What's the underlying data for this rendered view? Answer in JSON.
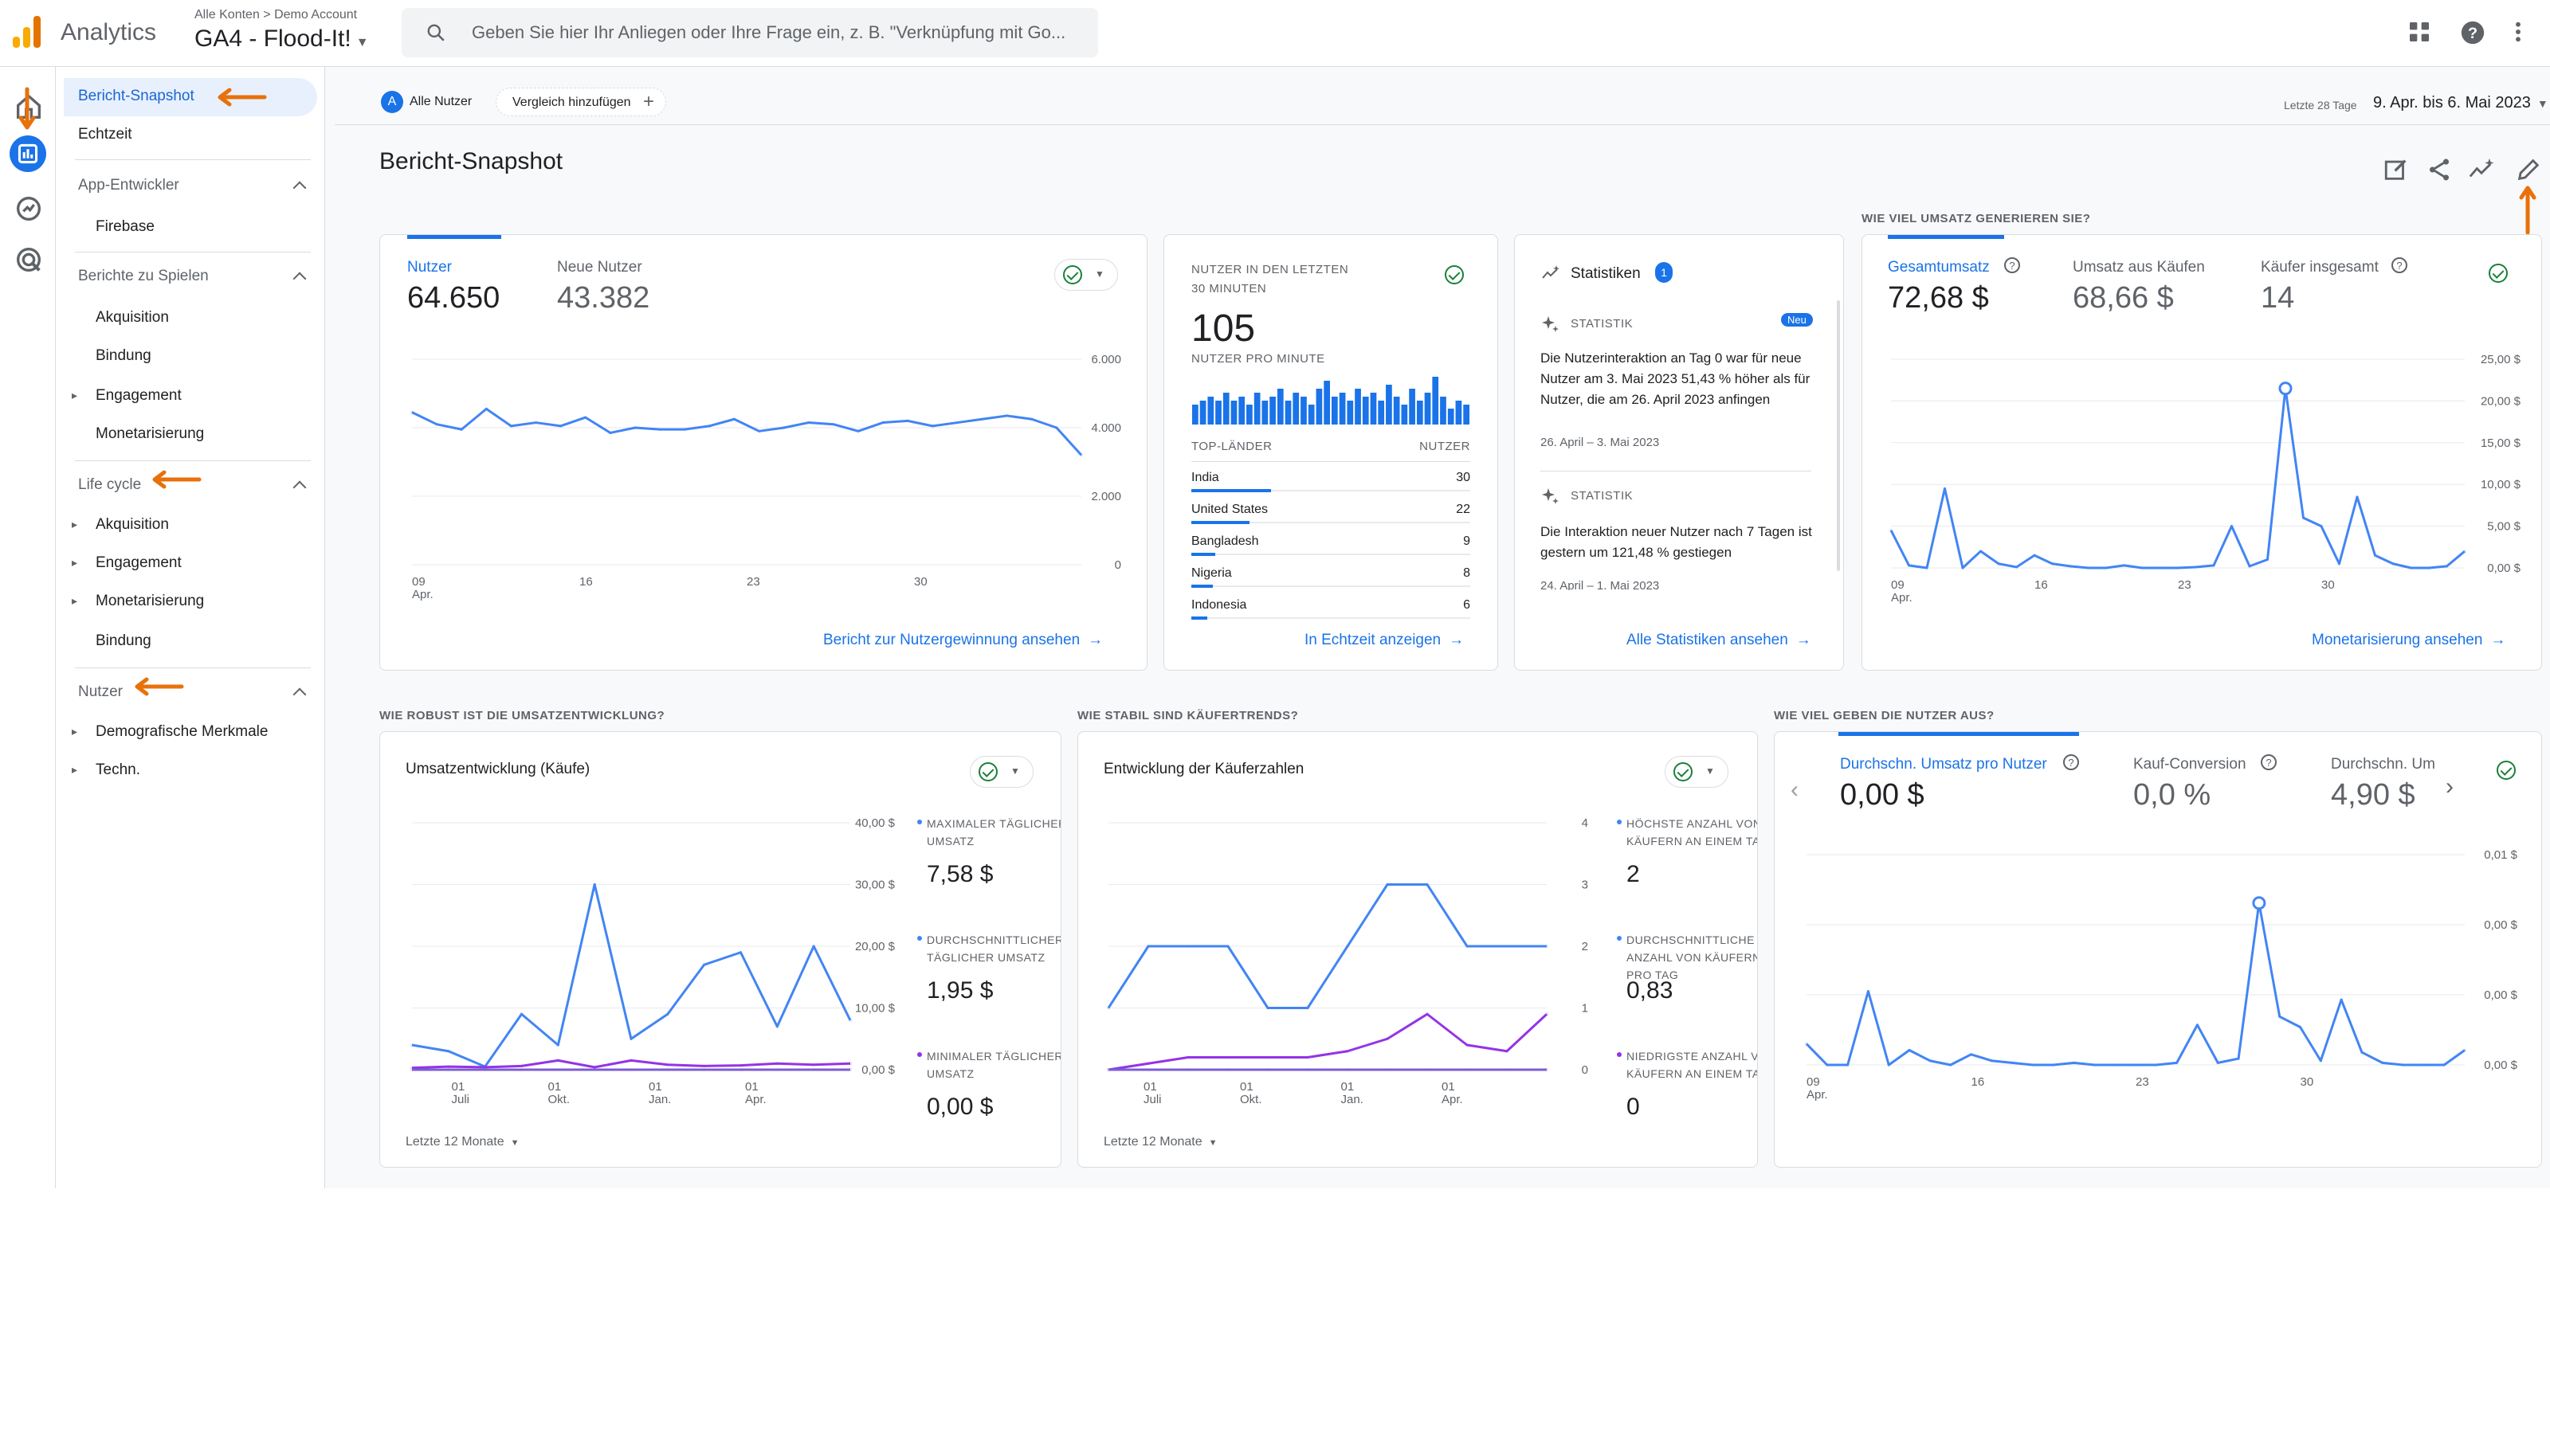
{
  "topbar": {
    "brand": "Analytics",
    "breadcrumb": "Alle Konten > Demo Account",
    "property": "GA4 - Flood-It!",
    "search_placeholder": "Geben Sie hier Ihr Anliegen oder Ihre Frage ein, z. B. \"Verknüpfung mit Go...",
    "colors": {
      "logo": [
        "#f9ab00",
        "#e37400"
      ]
    }
  },
  "sidenav": {
    "snapshot": "Bericht-Snapshot",
    "realtime": "Echtzeit",
    "app_dev": "App-Entwickler",
    "firebase": "Firebase",
    "games": "Berichte zu Spielen",
    "games_items": [
      "Akquisition",
      "Bindung",
      "Engagement",
      "Monetarisierung"
    ],
    "lifecycle": "Life cycle",
    "lifecycle_items": [
      "Akquisition",
      "Engagement",
      "Monetarisierung",
      "Bindung"
    ],
    "user": "Nutzer",
    "user_items": [
      "Demografische Merkmale",
      "Techn."
    ]
  },
  "filters": {
    "all_users_badge": "A",
    "all_users": "Alle Nutzer",
    "add_comparison": "Vergleich hinzufügen"
  },
  "date": {
    "label": "Letzte 28 Tage",
    "range": "9. Apr. bis 6. Mai 2023"
  },
  "page_title": "Bericht-Snapshot",
  "sections": {
    "revenue": "WIE VIEL UMSATZ GENERIEREN SIE?",
    "robust": "WIE ROBUST IST DIE UMSATZENTWICKLUNG?",
    "buyers": "WIE STABIL SIND KÄUFERTRENDS?",
    "spend": "WIE VIEL GEBEN DIE NUTZER AUS?"
  },
  "users_card": {
    "metrics": [
      {
        "label": "Nutzer",
        "value": "64.650"
      },
      {
        "label": "Neue Nutzer",
        "value": "43.382"
      }
    ],
    "link": "Bericht zur Nutzergewinnung ansehen"
  },
  "realtime_card": {
    "title_line1": "NUTZER IN DEN LETZTEN",
    "title_line2": "30 MINUTEN",
    "value": "105",
    "per_minute": "NUTZER PRO MINUTE",
    "col_country": "TOP-LÄNDER",
    "col_users": "NUTZER",
    "rows": [
      {
        "country": "India",
        "users": "30"
      },
      {
        "country": "United States",
        "users": "22"
      },
      {
        "country": "Bangladesh",
        "users": "9"
      },
      {
        "country": "Nigeria",
        "users": "8"
      },
      {
        "country": "Indonesia",
        "users": "6"
      }
    ],
    "link": "In Echtzeit anzeigen"
  },
  "insights_card": {
    "title": "Statistiken",
    "badge": "1",
    "new_badge": "Neu",
    "items": [
      {
        "tag": "STATISTIK",
        "text": "Die Nutzerinteraktion an Tag 0 war für neue Nutzer am 3. Mai 2023 51,43 % höher als für Nutzer, die am 26. April 2023 anfingen",
        "dates": "26. April – 3. Mai 2023"
      },
      {
        "tag": "STATISTIK",
        "text": "Die Interaktion neuer Nutzer nach 7 Tagen ist gestern um 121,48 % gestiegen",
        "dates": "24. April – 1. Mai 2023"
      }
    ],
    "link": "Alle Statistiken ansehen"
  },
  "revenue_card": {
    "metrics": [
      {
        "label": "Gesamtumsatz",
        "value": "72,68 $"
      },
      {
        "label": "Umsatz aus Käufen",
        "value": "68,66 $"
      },
      {
        "label": "Käufer insgesamt",
        "value": "14"
      }
    ],
    "link": "Monetarisierung ansehen"
  },
  "robust_card": {
    "title": "Umsatzentwicklung (Käufe)",
    "stats": [
      {
        "label": "MAXIMALER TÄGLICHER UMSATZ",
        "value": "7,58 $"
      },
      {
        "label": "DURCHSCHNITTLICHER TÄGLICHER UMSATZ",
        "value": "1,95 $"
      },
      {
        "label": "MINIMALER TÄGLICHER UMSATZ",
        "value": "0,00 $"
      }
    ],
    "footer": "Letzte 12 Monate"
  },
  "buyers_card": {
    "title": "Entwicklung der Käuferzahlen",
    "stats": [
      {
        "label": "HÖCHSTE ANZAHL VON KÄUFERN AN EINEM TAG",
        "value": "2"
      },
      {
        "label": "DURCHSCHNITTLICHE ANZAHL VON KÄUFERN PRO TAG",
        "value": "0,83"
      },
      {
        "label": "NIEDRIGSTE ANZAHL VON KÄUFERN AN EINEM TAG",
        "value": "0"
      }
    ],
    "footer": "Letzte 12 Monate"
  },
  "spend_card": {
    "metrics": [
      {
        "label": "Durchschn. Umsatz pro Nutzer",
        "value": "0,00 $"
      },
      {
        "label": "Kauf-Conversion",
        "value": "0,0 %"
      },
      {
        "label": "Durchschn. Um",
        "value": "4,90 $"
      }
    ]
  },
  "chart_data": [
    {
      "type": "line",
      "title": "Nutzer",
      "x": [
        "09 Apr.",
        "10",
        "11",
        "12",
        "13",
        "14",
        "15",
        "16",
        "17",
        "18",
        "19",
        "20",
        "21",
        "22",
        "23",
        "24",
        "25",
        "26",
        "27",
        "28",
        "29",
        "30",
        "01",
        "02",
        "03",
        "04",
        "05",
        "06"
      ],
      "x_tick_labels": [
        "09\nApr.",
        "16",
        "23",
        "30"
      ],
      "series": [
        {
          "name": "Nutzer",
          "values": [
            4450,
            4100,
            3950,
            4550,
            4050,
            4150,
            4050,
            4300,
            3850,
            4000,
            3950,
            3950,
            4050,
            4250,
            3900,
            4000,
            4150,
            4100,
            3900,
            4150,
            4200,
            4050,
            4150,
            4250,
            4350,
            4250,
            4000,
            3200
          ]
        }
      ],
      "yticks": [
        "6.000",
        "4.000",
        "2.000",
        "0"
      ],
      "ylim": [
        0,
        6000
      ]
    },
    {
      "type": "bar",
      "title": "NUTZER PRO MINUTE",
      "values": [
        5,
        6,
        7,
        6,
        8,
        6,
        7,
        5,
        8,
        6,
        7,
        9,
        6,
        8,
        7,
        5,
        9,
        11,
        7,
        8,
        6,
        9,
        7,
        8,
        6,
        10,
        7,
        5,
        9,
        6,
        8,
        12,
        7,
        4,
        6,
        5
      ],
      "ylim": [
        0,
        12
      ]
    },
    {
      "type": "line",
      "title": "Gesamtumsatz",
      "x_tick_labels": [
        "09\nApr.",
        "16",
        "23",
        "30"
      ],
      "series": [
        {
          "name": "Gesamtumsatz",
          "values": [
            4.5,
            0.3,
            0,
            9.5,
            0,
            2,
            0.5,
            0.1,
            1.5,
            0.5,
            0.2,
            0,
            0,
            0.3,
            0,
            0,
            0,
            0.1,
            0.3,
            5,
            0.2,
            1,
            21.5,
            6,
            5,
            0.5,
            8.5,
            1.5,
            0.5,
            0,
            0,
            0.2,
            2
          ]
        }
      ],
      "yticks": [
        "25,00 $",
        "20,00 $",
        "15,00 $",
        "10,00 $",
        "5,00 $",
        "0,00 $"
      ],
      "ylim": [
        0,
        25
      ]
    },
    {
      "type": "line",
      "title": "Umsatzentwicklung (Käufe)",
      "x_tick_labels": [
        "01\nJuli",
        "01\nOkt.",
        "01\nJan.",
        "01\nApr."
      ],
      "series": [
        {
          "name": "Umsatzentwicklung (Käufe)",
          "values": [
            4,
            3,
            0.5,
            9,
            4,
            30,
            5,
            9,
            17,
            19,
            7,
            20,
            8
          ]
        },
        {
          "name": "Umsatzentwicklung (Käufe)",
          "values": [
            0.3,
            0.5,
            0.4,
            0.6,
            1.5,
            0.4,
            1.5,
            0.8,
            0.6,
            0.7,
            1,
            0.8,
            1
          ]
        },
        {
          "name": "Umsatzentwicklung (Käufe)",
          "values": [
            0,
            0,
            0,
            0,
            0,
            0,
            0,
            0,
            0,
            0,
            0,
            0,
            0
          ]
        }
      ],
      "yticks": [
        "40,00 $",
        "30,00 $",
        "20,00 $",
        "10,00 $",
        "0,00 $"
      ],
      "ylim": [
        0,
        40
      ]
    },
    {
      "type": "line",
      "title": "Entwicklung der Käuferzahlen",
      "x_tick_labels": [
        "01\nJuli",
        "01\nOkt.",
        "01\nJan.",
        "01\nApr."
      ],
      "series": [
        {
          "name": "Entwicklung der Käuferzahlen",
          "values": [
            1,
            2,
            2,
            2,
            1,
            1,
            2,
            3,
            3,
            2,
            2,
            2
          ]
        },
        {
          "name": "Entwicklung der Käuferzahlen",
          "values": [
            0,
            0.1,
            0.2,
            0.2,
            0.2,
            0.2,
            0.3,
            0.5,
            0.9,
            0.4,
            0.3,
            0.9
          ]
        },
        {
          "name": "Entwicklung der Käuferzahlen",
          "values": [
            0,
            0,
            0,
            0,
            0,
            0,
            0,
            0,
            0,
            0,
            0,
            0
          ]
        }
      ],
      "yticks": [
        "4",
        "3",
        "2",
        "1",
        "0"
      ],
      "ylim": [
        0,
        4
      ]
    },
    {
      "type": "line",
      "title": "Durchschn. Umsatz pro Nutzer",
      "x_tick_labels": [
        "09\nApr.",
        "16",
        "23",
        "30"
      ],
      "series": [
        {
          "name": "Durchschn. Umsatz pro Nutzer",
          "values": [
            0.001,
            0,
            0,
            0.0035,
            0,
            0.0007,
            0.0002,
            0,
            0.0005,
            0.0002,
            0.0001,
            0,
            0,
            0.0001,
            0,
            0,
            0,
            0,
            0.0001,
            0.0019,
            0.0001,
            0.0003,
            0.0077,
            0.0023,
            0.0018,
            0.0002,
            0.0031,
            0.0006,
            0.0001,
            0,
            0,
            0,
            0.0007
          ]
        }
      ],
      "yticks": [
        "0,01 $",
        "0,00 $",
        "0,00 $",
        "0,00 $"
      ],
      "ylim": [
        0,
        0.01
      ]
    }
  ]
}
